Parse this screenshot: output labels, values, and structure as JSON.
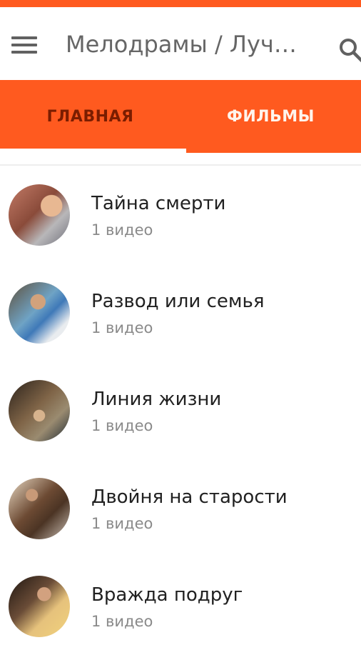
{
  "toolbar": {
    "title": "Мелодрамы / Луч…",
    "menu_icon": "hamburger-menu-icon",
    "search_icon": "search-icon"
  },
  "tabs": [
    {
      "label": "ГЛАВНАЯ",
      "selected": true
    },
    {
      "label": "ФИЛЬМЫ",
      "selected": false
    }
  ],
  "colors": {
    "accent": "#ff5a1f",
    "selected_tab_text": "#7a1d00",
    "unselected_tab_text": "#fff4ec",
    "title_text": "#212121",
    "subtitle_text": "#8a8a8a"
  },
  "playlists": [
    {
      "title": "Тайна смерти",
      "subtitle": "1 видео"
    },
    {
      "title": "Развод или семья",
      "subtitle": "1 видео"
    },
    {
      "title": "Линия жизни",
      "subtitle": "1 видео"
    },
    {
      "title": "Двойня на старости",
      "subtitle": "1 видео"
    },
    {
      "title": "Вражда подруг",
      "subtitle": "1 видео"
    }
  ]
}
